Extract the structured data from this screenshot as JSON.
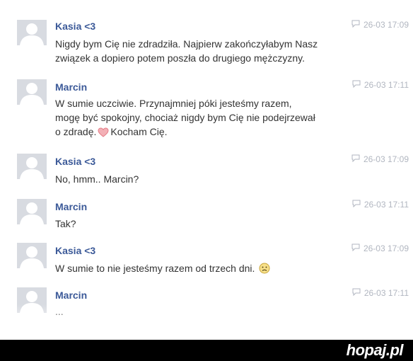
{
  "messages": [
    {
      "sender": "Kasia <3",
      "time": "26-03 17:09",
      "lines": [
        "Nigdy bym Cię nie zdradziła. Najpierw zakończyłabym Nasz",
        "związek a dopiero potem poszła do drugiego mężczyzny."
      ]
    },
    {
      "sender": "Marcin",
      "time": "26-03 17:11",
      "lines": [
        "W sumie uczciwie. Przynajmniej póki jesteśmy razem,",
        "mogę być spokojny, chociaż nigdy bym Cię nie podejrzewał",
        "o zdradę.",
        "Kocham Cię."
      ]
    },
    {
      "sender": "Kasia <3",
      "time": "26-03 17:09",
      "lines": [
        "No, hmm.. Marcin?"
      ]
    },
    {
      "sender": "Marcin",
      "time": "26-03 17:11",
      "lines": [
        "Tak?"
      ]
    },
    {
      "sender": "Kasia <3",
      "time": "26-03 17:09",
      "lines": [
        "W sumie to nie jesteśmy razem od trzech dni."
      ]
    },
    {
      "sender": "Marcin",
      "time": "26-03 17:11",
      "lines": [
        "..."
      ]
    }
  ],
  "icons": {
    "avatar": "default-profile-icon",
    "time": "chat-bubble-icon",
    "heart": "heart-emoji-icon",
    "sad": "sad-face-emoji-icon"
  },
  "watermark": "hopaj.pl",
  "colors": {
    "sender": "#3b5998",
    "text": "#333333",
    "timestamp": "#b1b6c0",
    "avatar_bg": "#d8dbe1",
    "footer_bg": "#000000"
  }
}
